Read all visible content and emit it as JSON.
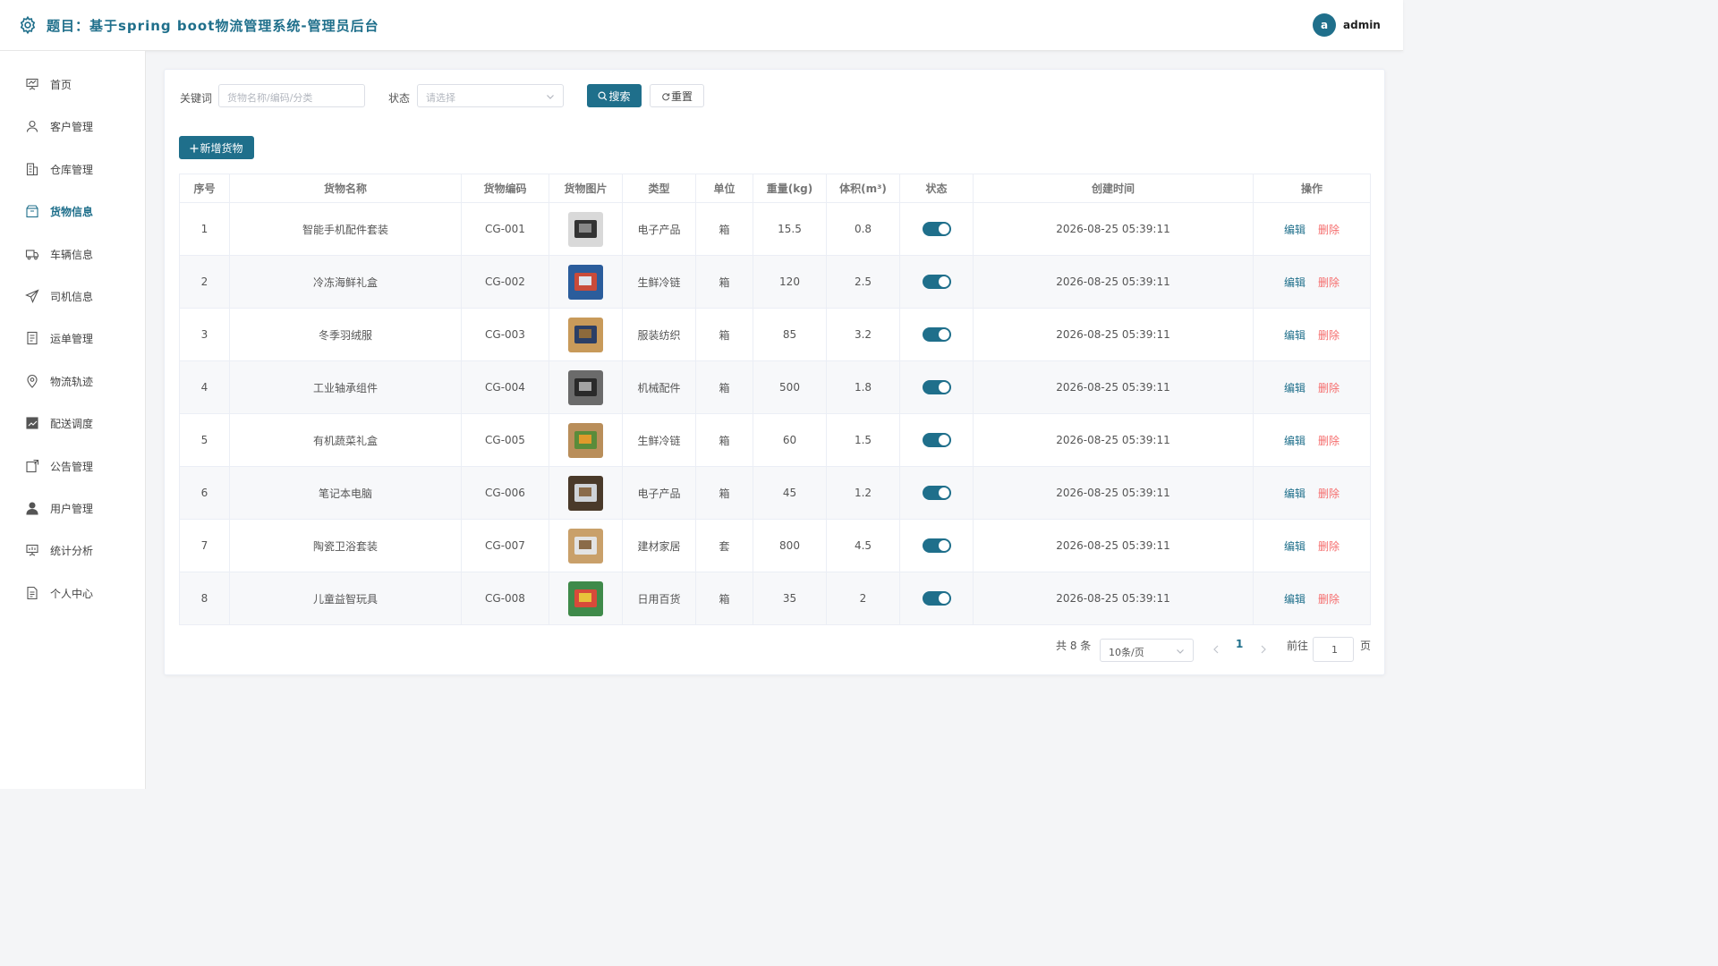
{
  "header": {
    "title": "题目：基于spring boot物流管理系统-管理员后台",
    "avatar_letter": "a",
    "username": "admin",
    "accent": "#1f6f8b"
  },
  "sidebar": {
    "items": [
      {
        "label": "首页",
        "icon": "presentation-icon"
      },
      {
        "label": "客户管理",
        "icon": "user-icon"
      },
      {
        "label": "仓库管理",
        "icon": "building-icon"
      },
      {
        "label": "货物信息",
        "icon": "box-icon",
        "active": true
      },
      {
        "label": "车辆信息",
        "icon": "truck-icon"
      },
      {
        "label": "司机信息",
        "icon": "send-icon"
      },
      {
        "label": "运单管理",
        "icon": "document-icon"
      },
      {
        "label": "物流轨迹",
        "icon": "location-icon"
      },
      {
        "label": "配送调度",
        "icon": "chart-icon"
      },
      {
        "label": "公告管理",
        "icon": "notice-icon"
      },
      {
        "label": "用户管理",
        "icon": "person-icon"
      },
      {
        "label": "统计分析",
        "icon": "stats-icon"
      },
      {
        "label": "个人中心",
        "icon": "profile-doc-icon"
      }
    ]
  },
  "filters": {
    "keyword_label": "关键词",
    "keyword_placeholder": "货物名称/编码/分类",
    "status_label": "状态",
    "status_placeholder": "请选择",
    "search_label": "搜索",
    "reset_label": "重置"
  },
  "add_button": "新增货物",
  "table": {
    "headers": [
      "序号",
      "货物名称",
      "货物编码",
      "货物图片",
      "类型",
      "单位",
      "重量(kg)",
      "体积(m³)",
      "状态",
      "创建时间",
      "操作"
    ],
    "edit_label": "编辑",
    "delete_label": "删除",
    "rows": [
      {
        "no": "1",
        "name": "智能手机配件套装",
        "code": "CG-001",
        "type": "电子产品",
        "unit": "箱",
        "weight": "15.5",
        "volume": "0.8",
        "status": true,
        "created": "2026-08-25 05:39:11"
      },
      {
        "no": "2",
        "name": "冷冻海鲜礼盒",
        "code": "CG-002",
        "type": "生鲜冷链",
        "unit": "箱",
        "weight": "120",
        "volume": "2.5",
        "status": true,
        "created": "2026-08-25 05:39:11"
      },
      {
        "no": "3",
        "name": "冬季羽绒服",
        "code": "CG-003",
        "type": "服装纺织",
        "unit": "箱",
        "weight": "85",
        "volume": "3.2",
        "status": true,
        "created": "2026-08-25 05:39:11"
      },
      {
        "no": "4",
        "name": "工业轴承组件",
        "code": "CG-004",
        "type": "机械配件",
        "unit": "箱",
        "weight": "500",
        "volume": "1.8",
        "status": true,
        "created": "2026-08-25 05:39:11"
      },
      {
        "no": "5",
        "name": "有机蔬菜礼盒",
        "code": "CG-005",
        "type": "生鲜冷链",
        "unit": "箱",
        "weight": "60",
        "volume": "1.5",
        "status": true,
        "created": "2026-08-25 05:39:11"
      },
      {
        "no": "6",
        "name": "笔记本电脑",
        "code": "CG-006",
        "type": "电子产品",
        "unit": "箱",
        "weight": "45",
        "volume": "1.2",
        "status": true,
        "created": "2026-08-25 05:39:11"
      },
      {
        "no": "7",
        "name": "陶瓷卫浴套装",
        "code": "CG-007",
        "type": "建材家居",
        "unit": "套",
        "weight": "800",
        "volume": "4.5",
        "status": true,
        "created": "2026-08-25 05:39:11"
      },
      {
        "no": "8",
        "name": "儿童益智玩具",
        "code": "CG-008",
        "type": "日用百货",
        "unit": "箱",
        "weight": "35",
        "volume": "2",
        "status": true,
        "created": "2026-08-25 05:39:11"
      }
    ]
  },
  "pagination": {
    "total_text": "共 8 条",
    "page_size": "10条/页",
    "current_page": "1",
    "goto_label": "前往",
    "goto_value": "1",
    "page_suffix": "页"
  }
}
